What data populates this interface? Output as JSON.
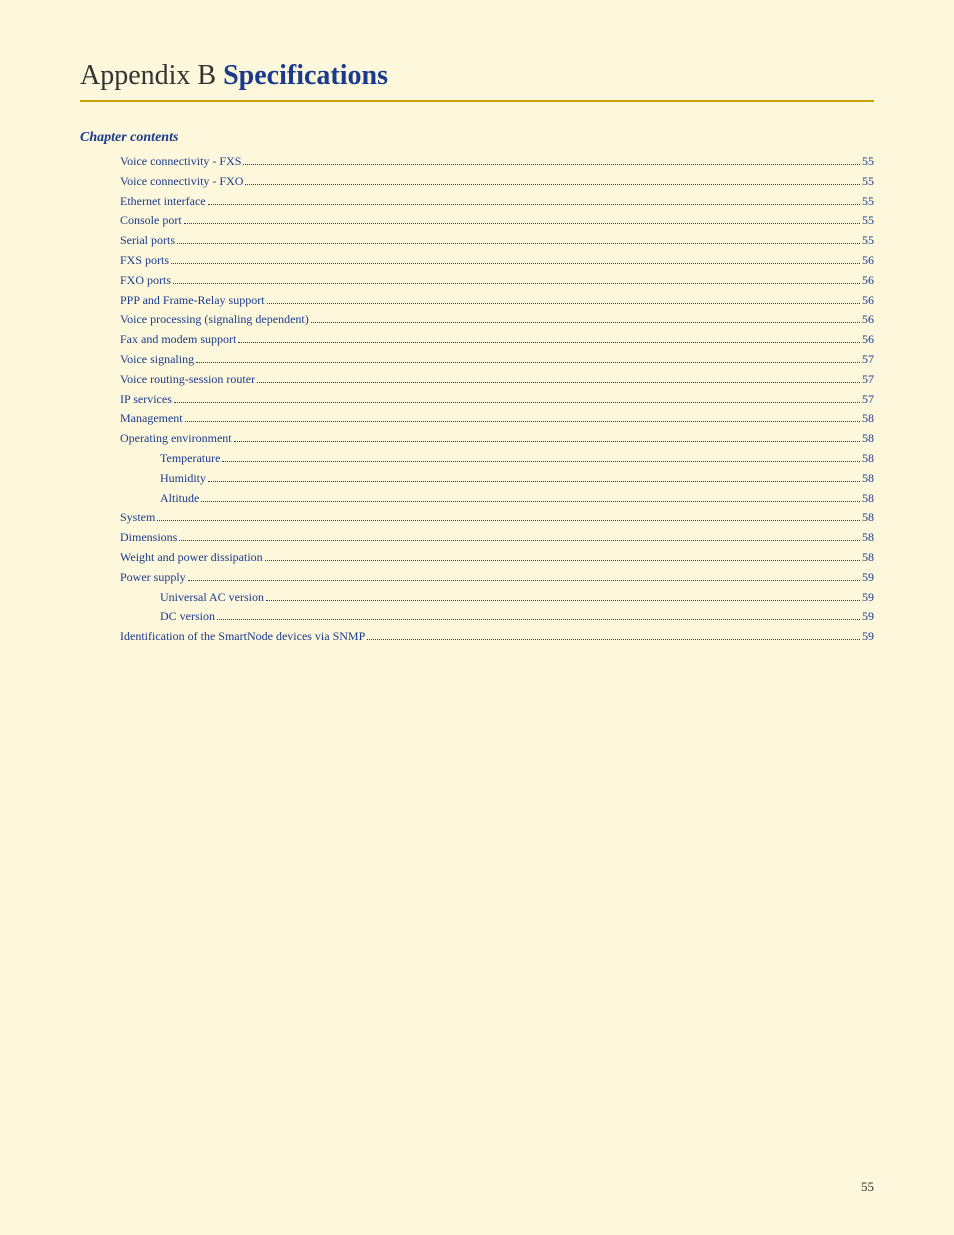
{
  "header": {
    "appendix_prefix": "Appendix B ",
    "appendix_title": "Specifications"
  },
  "chapter_contents_label": "Chapter contents",
  "toc_entries": [
    {
      "label": "Voice connectivity - FXS",
      "page": "55",
      "indent": 1
    },
    {
      "label": "Voice connectivity - FXO",
      "page": "55",
      "indent": 1
    },
    {
      "label": "Ethernet interface",
      "page": "55",
      "indent": 1
    },
    {
      "label": "Console port",
      "page": "55",
      "indent": 1
    },
    {
      "label": "Serial ports",
      "page": "55",
      "indent": 1
    },
    {
      "label": "FXS ports",
      "page": "56",
      "indent": 1
    },
    {
      "label": "FXO ports",
      "page": "56",
      "indent": 1
    },
    {
      "label": "PPP and Frame-Relay support",
      "page": "56",
      "indent": 1
    },
    {
      "label": "Voice processing (signaling dependent)",
      "page": "56",
      "indent": 1
    },
    {
      "label": "Fax and modem support",
      "page": "56",
      "indent": 1
    },
    {
      "label": "Voice signaling",
      "page": "57",
      "indent": 1
    },
    {
      "label": "Voice routing-session router",
      "page": "57",
      "indent": 1
    },
    {
      "label": "IP services",
      "page": "57",
      "indent": 1
    },
    {
      "label": "Management",
      "page": "58",
      "indent": 1
    },
    {
      "label": "Operating environment",
      "page": "58",
      "indent": 1
    },
    {
      "label": "Temperature",
      "page": "58",
      "indent": 2
    },
    {
      "label": "Humidity",
      "page": "58",
      "indent": 2
    },
    {
      "label": "Altitude",
      "page": "58",
      "indent": 2
    },
    {
      "label": "System",
      "page": "58",
      "indent": 1
    },
    {
      "label": "Dimensions",
      "page": "58",
      "indent": 1
    },
    {
      "label": "Weight and power dissipation",
      "page": "58",
      "indent": 1
    },
    {
      "label": "Power supply",
      "page": "59",
      "indent": 1
    },
    {
      "label": "Universal AC version",
      "page": "59",
      "indent": 2
    },
    {
      "label": "DC version",
      "page": "59",
      "indent": 2
    },
    {
      "label": "Identification of the SmartNode devices via SNMP",
      "page": "59",
      "indent": 1
    }
  ],
  "page_number": "55"
}
